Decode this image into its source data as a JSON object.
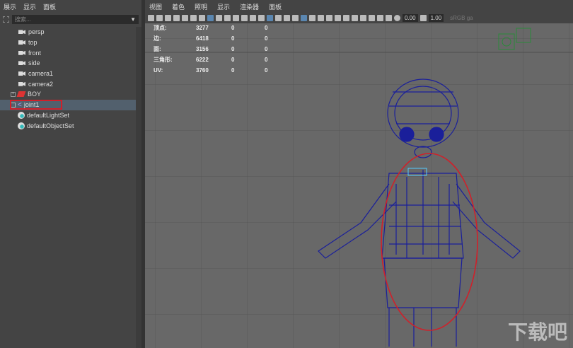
{
  "outliner": {
    "menu": [
      "展示",
      "显示",
      "面板"
    ],
    "search_placeholder": "搜索...",
    "items": [
      {
        "label": "persp",
        "icon": "camera-icon"
      },
      {
        "label": "top",
        "icon": "camera-icon"
      },
      {
        "label": "front",
        "icon": "camera-icon"
      },
      {
        "label": "side",
        "icon": "camera-icon"
      },
      {
        "label": "camera1",
        "icon": "camera-icon"
      },
      {
        "label": "camera2",
        "icon": "camera-icon"
      },
      {
        "label": "BOY",
        "icon": "mesh-group-icon"
      },
      {
        "label": "joint1",
        "icon": "joint-icon",
        "selected": true
      },
      {
        "label": "defaultLightSet",
        "icon": "set-icon"
      },
      {
        "label": "defaultObjectSet",
        "icon": "set-icon"
      }
    ]
  },
  "viewport": {
    "menu": [
      "视图",
      "着色",
      "照明",
      "显示",
      "渲染器",
      "面板"
    ],
    "exposure": "0.00",
    "gamma": "1.00",
    "color_space": "sRGB ga",
    "hud": [
      [
        "顶点:",
        "3277",
        "0",
        "0"
      ],
      [
        "边:",
        "6418",
        "0",
        "0"
      ],
      [
        "面:",
        "3156",
        "0",
        "0"
      ],
      [
        "三角形:",
        "6222",
        "0",
        "0"
      ],
      [
        "UV:",
        "3760",
        "0",
        "0"
      ]
    ]
  },
  "watermark": "下载吧",
  "colors": {
    "wire": "#1a1f9a",
    "highlight": "#d0202a"
  }
}
